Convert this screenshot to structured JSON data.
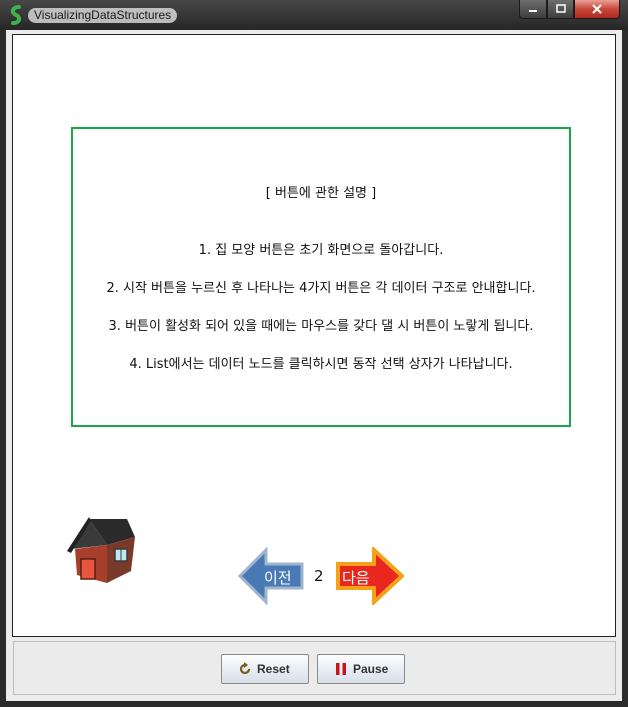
{
  "window": {
    "title": "VisualizingDataStructures"
  },
  "info": {
    "heading": "[ 버튼에 관한 설명 ]",
    "lines": [
      "1. 집 모양 버튼은 초기 화면으로 돌아갑니다.",
      "2. 시작 버튼을 누르신 후 나타나는 4가지 버튼은 각 데이터 구조로 안내합니다.",
      "3. 버튼이 활성화 되어 있을 때에는 마우스를 갖다 댈 시 버튼이 노랗게 됩니다.",
      "4. List에서는 데이터 노드를 클릭하시면 동작 선택 상자가 나타납니다."
    ]
  },
  "nav": {
    "prev_label": "이전",
    "page": "2",
    "next_label": "다음"
  },
  "controls": {
    "reset_label": "Reset",
    "pause_label": "Pause"
  },
  "colors": {
    "border_green": "#1aa54b",
    "prev_blue": "#4a7ab5",
    "next_red": "#e8281e",
    "next_orange": "#f7a11b"
  }
}
